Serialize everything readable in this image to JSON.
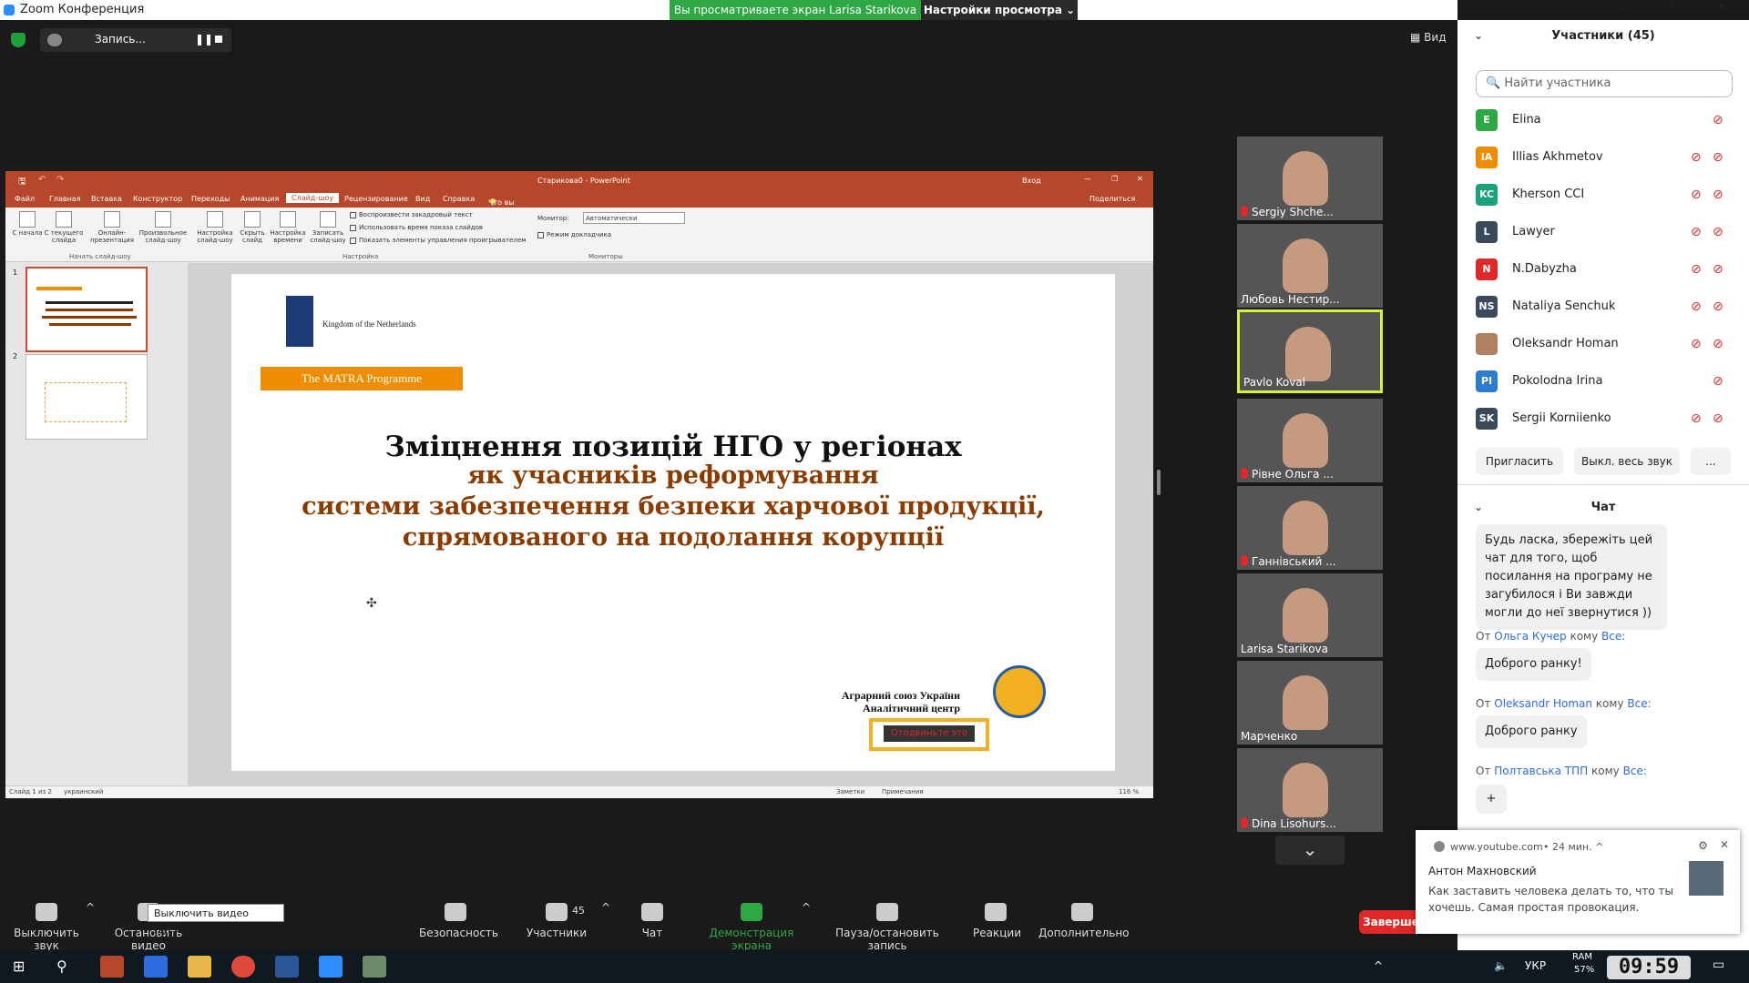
{
  "window": {
    "title": "Zoom Конференция",
    "viewing": "Вы просматриваете экран Larisa Starikova",
    "view_options": "Настройки просмотра ⌄",
    "view_label": "Вид"
  },
  "recording": {
    "label": "Запись..."
  },
  "ppt": {
    "doc_title": "Старикова0 - PowerPoint",
    "login": "Вход",
    "share": "Поделиться",
    "tell_me": "Что вы хотите сделать?",
    "tabs": [
      "Файл",
      "Главная",
      "Вставка",
      "Конструктор",
      "Переходы",
      "Анимация",
      "Слайд-шоу",
      "Рецензирование",
      "Вид",
      "Справка"
    ],
    "selected_tab": "Слайд-шоу",
    "ribbon": {
      "btn1": "С начала",
      "btn2": "С текущего слайда",
      "btn3": "Онлайн-презентация",
      "btn4": "Произвольное слайд-шоу",
      "group1": "Начать слайд-шоу",
      "btn5": "Настройка слайд-шоу",
      "btn6": "Скрыть слайд",
      "btn7": "Настройка времени",
      "btn8": "Записать слайд-шоу",
      "chk1": "Воспроизвести закадровый текст",
      "chk2": "Использовать время показа слайдов",
      "chk3": "Показать элементы управления проигрывателем",
      "group2": "Настройка",
      "monitor_label": "Монитор:",
      "monitor_value": "Автоматически",
      "chk4": "Режим докладчика",
      "group3": "Мониторы"
    },
    "thumb_nums": [
      "1",
      "2"
    ],
    "slide": {
      "logo_text": "Kingdom of the Netherlands",
      "programme": "The MATRA Programme",
      "title1": "Зміцнення позицій НГО у регіонах",
      "title2": "як учасників реформування",
      "title3": "системи забезпечення безпеки харчової продукції,",
      "title4": "спрямованого на подолання корупції",
      "org1": "Аграрний союз України",
      "org2": "Аналітичний центр",
      "stamp": "Отодвиньте это"
    },
    "status": {
      "slide": "Слайд 1 из 2",
      "lang": "украинский",
      "notes": "Заметки",
      "comments": "Примечания",
      "zoom": "116 %"
    }
  },
  "gallery": [
    {
      "name": "Sergiy Shche...",
      "muted": true
    },
    {
      "name": "Любовь Нестир...",
      "muted": false
    },
    {
      "name": "Pavlo Koval",
      "muted": false,
      "active": true
    },
    {
      "name": "Рівне Ольга ...",
      "muted": true
    },
    {
      "name": "Ганнівський ...",
      "muted": true
    },
    {
      "name": "Larisa Starikova",
      "muted": false
    },
    {
      "name": "Марченко",
      "muted": false
    },
    {
      "name": "Dina Lisohurs...",
      "muted": true
    }
  ],
  "participants": {
    "title": "Участники (45)",
    "search_placeholder": "Найти участника",
    "list": [
      {
        "initials": "E",
        "name": "Elina",
        "color": "#2ea844",
        "video_off": false
      },
      {
        "initials": "IA",
        "name": "Illias Akhmetov",
        "color": "#f08c00",
        "video_off": true
      },
      {
        "initials": "KC",
        "name": "Kherson CCI",
        "color": "#1aa37a",
        "video_off": true
      },
      {
        "initials": "L",
        "name": "Lawyer",
        "color": "#3a4a5a",
        "video_off": true
      },
      {
        "initials": "N",
        "name": "N.Dabyzha",
        "color": "#e02828",
        "video_off": true
      },
      {
        "initials": "NS",
        "name": "Nataliya Senchuk",
        "color": "#3a4a5a",
        "video_off": true
      },
      {
        "initials": "",
        "name": "Oleksandr Homan",
        "color": "#b08060",
        "video_off": true
      },
      {
        "initials": "PI",
        "name": "Pokolodna Irina",
        "color": "#2d7cd0",
        "video_off": false
      },
      {
        "initials": "SK",
        "name": "Sergii Korniienko",
        "color": "#3a4a5a",
        "video_off": true
      }
    ],
    "invite": "Пригласить",
    "mute_all": "Выкл. весь звук",
    "more": "..."
  },
  "chat": {
    "title": "Чат",
    "msg1": "Будь ласка, збережіть цей чат для того, щоб посилання на програму не загубилося і Ви завжди могли до неї звернутися ))",
    "from2_prefix": "От",
    "from2_name": "Ольга Кучер",
    "from2_to": "кому",
    "from2_all": "Все:",
    "msg2": "Доброго ранку!",
    "from3_name": "Oleksandr Homan",
    "msg3": "Доброго ранку",
    "from4_name": "Полтавська ТПП",
    "plus": "+"
  },
  "toolbar": {
    "mute": "Выключить звук",
    "video": "Остановить видео",
    "video_tooltip": "Выключить видео (Alt+V)",
    "security": "Безопасность",
    "participants": "Участники",
    "participants_count": "45",
    "chat": "Чат",
    "share": "Демонстрация экрана",
    "pause_rec": "Пауза/остановить запись",
    "reactions": "Реакции",
    "more": "Дополнительно",
    "end": "Заверше"
  },
  "notification": {
    "source": "www.youtube.com",
    "time": "• 24 мин. ^",
    "author": "Антон Махновский",
    "text": "Как заставить человека делать то, что ты хочешь. Самая простая провокация."
  },
  "taskbar": {
    "lang": "УКР",
    "ram_label": "RAM",
    "ram_value": "57%",
    "clock": "09:59"
  },
  "colors": {
    "accent_green": "#2ea844",
    "ppt_red": "#b7472a",
    "zoom_blue": "#2d8cff",
    "danger": "#e02828"
  }
}
